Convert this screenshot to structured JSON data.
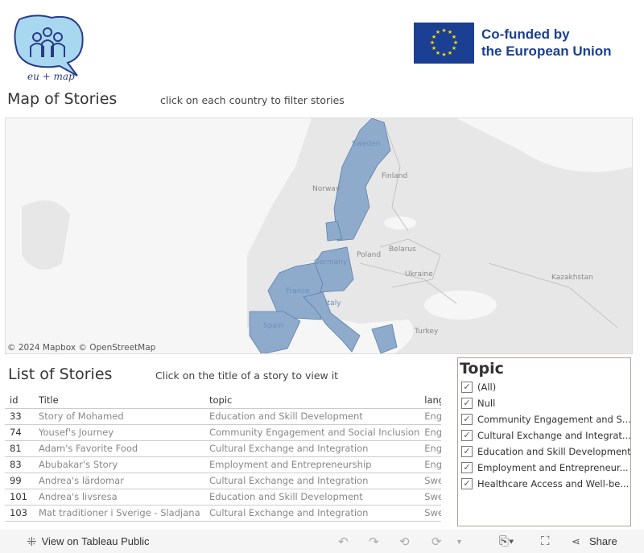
{
  "logo": {
    "text": "eu + map"
  },
  "eu_badge": {
    "line1": "Co-funded by",
    "line2": "the European Union",
    "flag_color": "#1a3f93",
    "star_color": "#ffdd00"
  },
  "map_section": {
    "title": "Map of Stories",
    "hint": "click on each country to filter stories",
    "attribution": "© 2024 Mapbox  © OpenStreetMap",
    "highlight_color": "#8fabcc",
    "highlighted_countries": [
      "Sweden",
      "Germany",
      "France",
      "Spain",
      "Italy"
    ],
    "labels": [
      "Sweden",
      "Finland",
      "Norway",
      "Poland",
      "Belarus",
      "Germany",
      "Ukraine",
      "France",
      "Italy",
      "Spain",
      "Turkey",
      "Kazakhstan"
    ]
  },
  "list_section": {
    "title": "List of Stories",
    "hint": "Click on the title of a story to view it",
    "columns": [
      "id",
      "Title",
      "topic",
      "langu"
    ],
    "rows": [
      [
        "33",
        "Story of Mohamed",
        "Education and Skill Development",
        "Engli"
      ],
      [
        "74",
        "Yousef's Journey",
        "Community Engagement and Social Inclusion",
        "Engli"
      ],
      [
        "81",
        "Adam's Favorite Food",
        "Cultural Exchange and Integration",
        "Engli"
      ],
      [
        "83",
        "Abubakar's Story",
        "Employment and Entrepreneurship",
        "Engli"
      ],
      [
        "99",
        "Andrea's lärdomar",
        "Cultural Exchange and Integration",
        "Swed"
      ],
      [
        "101",
        "Andrea's livsresa",
        "Education and Skill Development",
        "Swed"
      ],
      [
        "103",
        "Mat traditioner i Sverige - Sladjana",
        "Cultural Exchange and Integration",
        "Swed"
      ]
    ]
  },
  "topic_filter": {
    "title": "Topic",
    "options": [
      {
        "label": "(All)",
        "checked": true
      },
      {
        "label": "Null",
        "checked": true
      },
      {
        "label": "Community Engagement and S...",
        "checked": true
      },
      {
        "label": "Cultural Exchange and Integrat...",
        "checked": true
      },
      {
        "label": "Education and Skill Development",
        "checked": true
      },
      {
        "label": "Employment and Entrepreneur...",
        "checked": true
      },
      {
        "label": "Healthcare Access and Well-be...",
        "checked": true
      }
    ]
  },
  "toolbar": {
    "view_label": "View on Tableau Public",
    "share_label": "Share"
  }
}
